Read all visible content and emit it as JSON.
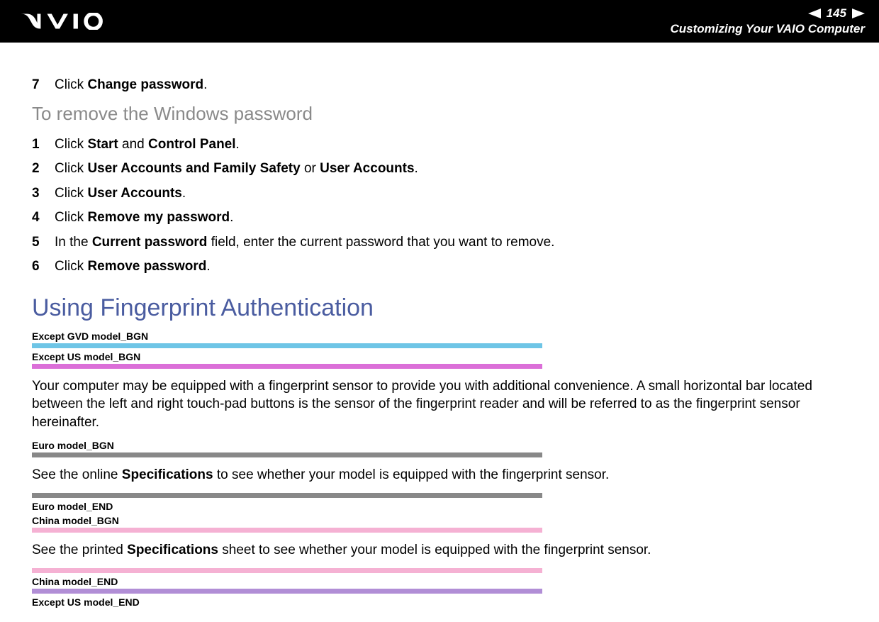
{
  "header": {
    "page_number": "145",
    "subtitle": "Customizing Your VAIO Computer"
  },
  "top_step": {
    "num": "7",
    "prefix": "Click ",
    "bold": "Change password",
    "suffix": "."
  },
  "subheading": "To remove the Windows password",
  "steps": [
    {
      "num": "1",
      "parts": [
        "Click ",
        "<b>Start</b>",
        " and ",
        "<b>Control Panel</b>",
        "."
      ]
    },
    {
      "num": "2",
      "parts": [
        "Click ",
        "<b>User Accounts and Family Safety</b>",
        " or ",
        "<b>User Accounts</b>",
        "."
      ]
    },
    {
      "num": "3",
      "parts": [
        "Click ",
        "<b>User Accounts</b>",
        "."
      ]
    },
    {
      "num": "4",
      "parts": [
        "Click ",
        "<b>Remove my password</b>",
        "."
      ]
    },
    {
      "num": "5",
      "parts": [
        "In the ",
        "<b>Current password</b>",
        " field, enter the current password that you want to remove."
      ]
    },
    {
      "num": "6",
      "parts": [
        "Click ",
        "<b>Remove password</b>",
        "."
      ]
    }
  ],
  "main_heading": "Using Fingerprint Authentication",
  "tags": {
    "except_gvd_bgn": "Except GVD model_BGN",
    "except_us_bgn": "Except US model_BGN",
    "euro_bgn": "Euro model_BGN",
    "euro_end": "Euro model_END",
    "china_bgn": "China model_BGN",
    "china_end": "China model_END",
    "except_us_end": "Except US model_END"
  },
  "para1": "Your computer may be equipped with a fingerprint sensor to provide you with additional convenience. A small horizontal bar located between the left and right touch-pad buttons is the sensor of the fingerprint reader and will be referred to as the fingerprint sensor hereinafter.",
  "para2_prefix": "See the online ",
  "para2_bold": "Specifications",
  "para2_suffix": " to see whether your model is equipped with the fingerprint sensor.",
  "para3_prefix": "See the printed ",
  "para3_bold": "Specifications",
  "para3_suffix": " sheet to see whether your model is equipped with the fingerprint sensor."
}
